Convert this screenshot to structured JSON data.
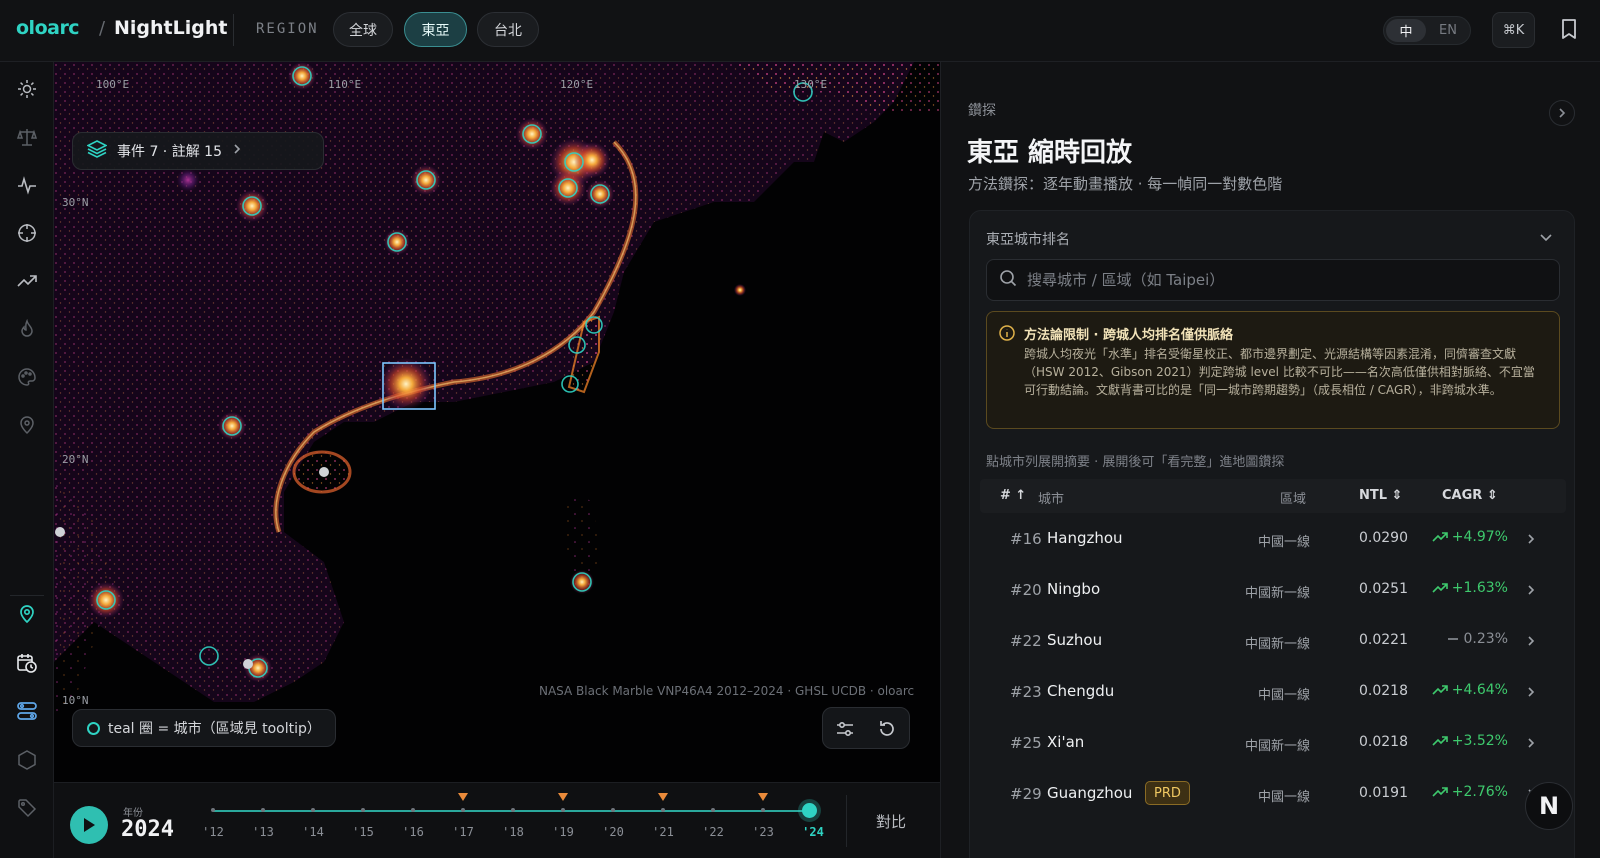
{
  "header": {
    "logo": "oloarc",
    "separator": "/",
    "app_title": "NightLight",
    "region_label": "REGION",
    "region_tabs": [
      {
        "label": "全球",
        "active": false
      },
      {
        "label": "東亞",
        "active": true
      },
      {
        "label": "台北",
        "active": false
      }
    ],
    "lang": {
      "zh": "中",
      "en": "EN",
      "active": "zh"
    },
    "command_shortcut": "⌘K"
  },
  "rail": {
    "icons": [
      "sun-icon",
      "scale-icon",
      "pulse-icon",
      "crosshair-icon",
      "trend-icon",
      "flame-icon",
      "palette-icon",
      "pin-icon",
      "location-pin-icon",
      "calendar-clock-icon",
      "route-icon",
      "hexagon-icon",
      "tag-icon"
    ],
    "active": [
      "location-pin-icon",
      "calendar-clock-icon",
      "route-icon"
    ]
  },
  "map": {
    "lon_labels": [
      "100°E",
      "110°E",
      "120°E",
      "130°E"
    ],
    "lat_labels": [
      "30°N",
      "20°N",
      "10°N"
    ],
    "event_chip": "事件 7 · 註解 15",
    "legend": "teal 圈 = 城市（區域見 tooltip）",
    "attribution": "NASA Black Marble VNP46A4 2012–2024 · GHSL UCDB · oloarc",
    "colors": {
      "teal": "#2fd3c3",
      "glow": "#ff8a2a",
      "purple": "#7a1f8c"
    }
  },
  "timeline": {
    "year_caption": "年份",
    "current_year": "2024",
    "ticks": [
      "'12",
      "'13",
      "'14",
      "'15",
      "'16",
      "'17",
      "'18",
      "'19",
      "'20",
      "'21",
      "'22",
      "'23",
      "'24"
    ],
    "event_marker_ticks": [
      "'17",
      "'19",
      "'21",
      "'23"
    ],
    "compare_label": "對比"
  },
  "panel": {
    "kicker": "鑽探",
    "title": "東亞 縮時回放",
    "subtitle": "方法鑽探：逐年動畫播放 · 每一幀同一對數色階",
    "card_title": "東亞城市排名",
    "search_placeholder": "搜尋城市 / 區域（如 Taipei）",
    "warning": {
      "title": "方法論限制 · 跨城人均排名僅供脈絡",
      "body": "跨城人均夜光「水準」排名受衛星校正、都市邊界劃定、光源結構等因素混淆，同儕審查文獻（HSW 2012、Gibson 2021）判定跨城 level 比較不可比——名次高低僅供相對脈絡、不宜當可行動結論。文獻背書可比的是「同一城市跨期趨勢」（成長相位 / CAGR），非跨城水準。"
    },
    "hint": "點城市列展開摘要 · 展開後可「看完整」進地圖鑽探",
    "columns": {
      "rank": "#",
      "city": "城市",
      "region": "區域",
      "ntl": "NTL",
      "cagr": "CAGR"
    },
    "rows": [
      {
        "rank": "#16",
        "city": "Hangzhou",
        "tag": "",
        "region": "中國一線",
        "ntl": "0.0290",
        "cagr": "+4.97%",
        "trend": "up"
      },
      {
        "rank": "#20",
        "city": "Ningbo",
        "tag": "",
        "region": "中國新一線",
        "ntl": "0.0251",
        "cagr": "+1.63%",
        "trend": "up"
      },
      {
        "rank": "#22",
        "city": "Suzhou",
        "tag": "",
        "region": "中國新一線",
        "ntl": "0.0221",
        "cagr": "0.23%",
        "trend": "flat"
      },
      {
        "rank": "#23",
        "city": "Chengdu",
        "tag": "",
        "region": "中國一線",
        "ntl": "0.0218",
        "cagr": "+4.64%",
        "trend": "up"
      },
      {
        "rank": "#25",
        "city": "Xi'an",
        "tag": "",
        "region": "中國新一線",
        "ntl": "0.0218",
        "cagr": "+3.52%",
        "trend": "up"
      },
      {
        "rank": "#29",
        "city": "Guangzhou",
        "tag": "PRD",
        "region": "中國一線",
        "ntl": "0.0191",
        "cagr": "+2.76%",
        "trend": "up"
      }
    ]
  },
  "compass": "N"
}
